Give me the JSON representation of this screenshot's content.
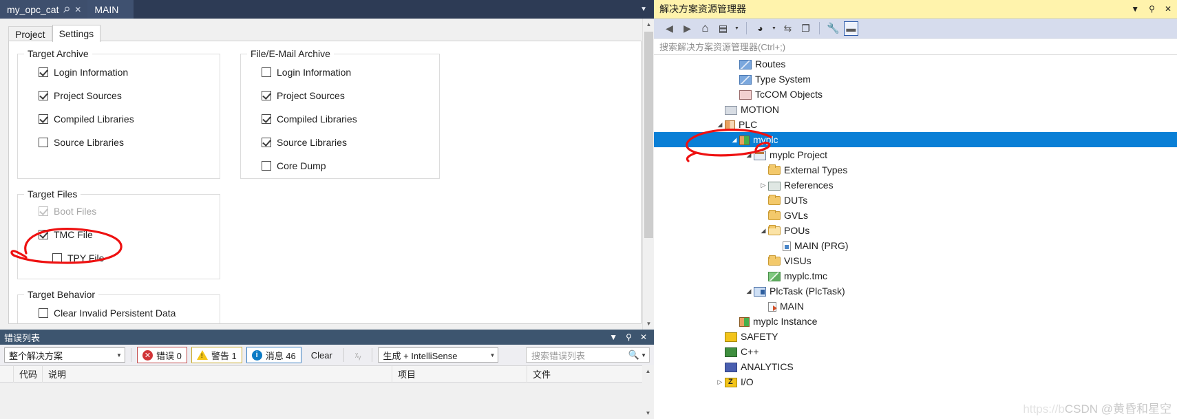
{
  "document_tabs": [
    {
      "label": "my_opc_cat",
      "pin_icon": "pin-icon",
      "close_icon": "close-icon",
      "active": true
    },
    {
      "label": "MAIN",
      "active": false
    }
  ],
  "tabstrip_overflow_icon": "chevron-down-icon",
  "inner_tabs": [
    {
      "label": "Project",
      "active": false
    },
    {
      "label": "Settings",
      "active": true
    }
  ],
  "settings": {
    "groups": [
      {
        "title": "Target Archive",
        "items": [
          {
            "label": "Login Information",
            "checked": true,
            "disabled": false
          },
          {
            "label": "Project Sources",
            "checked": true,
            "disabled": false
          },
          {
            "label": "Compiled Libraries",
            "checked": true,
            "disabled": false
          },
          {
            "label": "Source Libraries",
            "checked": false,
            "disabled": false
          }
        ]
      },
      {
        "title": "File/E-Mail Archive",
        "items": [
          {
            "label": "Login Information",
            "checked": false,
            "disabled": false
          },
          {
            "label": "Project Sources",
            "checked": true,
            "disabled": false
          },
          {
            "label": "Compiled Libraries",
            "checked": true,
            "disabled": false
          },
          {
            "label": "Source Libraries",
            "checked": true,
            "disabled": false
          },
          {
            "label": "Core Dump",
            "checked": false,
            "disabled": false
          }
        ]
      },
      {
        "title": "Target Files",
        "items": [
          {
            "label": "Boot Files",
            "checked": true,
            "disabled": true
          },
          {
            "label": "TMC File",
            "checked": true,
            "disabled": false
          },
          {
            "label": "TPY File",
            "checked": false,
            "disabled": false
          }
        ]
      },
      {
        "title": "Target Behavior",
        "items": [
          {
            "label": "Clear Invalid Persistent Data",
            "checked": false,
            "disabled": false
          }
        ]
      }
    ]
  },
  "error_list": {
    "title": "错误列表",
    "titlebar_icons": [
      "chevron-down-icon",
      "pin-icon",
      "close-icon"
    ],
    "scope_combo": {
      "value": "整个解决方案",
      "caret_icon": "chevron-down-icon"
    },
    "filters": [
      {
        "label": "错误 0",
        "icon": "error-icon"
      },
      {
        "label": "警告 1",
        "icon": "warning-icon"
      },
      {
        "label": "消息 46",
        "icon": "info-icon"
      }
    ],
    "clear_label": "Clear",
    "toggle_icon": "sort-xy-icon",
    "build_combo": {
      "value": "生成 + IntelliSense",
      "caret_icon": "chevron-down-icon"
    },
    "search": {
      "placeholder": "搜索错误列表",
      "icon": "search-icon",
      "caret_icon": "chevron-down-icon"
    },
    "columns": [
      "",
      "代码",
      "说明",
      "项目",
      "文件"
    ]
  },
  "solution_explorer": {
    "title": "解决方案资源管理器",
    "title_icons": [
      "chevron-down-icon",
      "pin-icon",
      "close-icon"
    ],
    "toolbar": [
      {
        "name": "back-icon",
        "glyph": "◄",
        "state": "disabled"
      },
      {
        "name": "forward-icon",
        "glyph": "►",
        "state": "disabled"
      },
      {
        "name": "home-icon",
        "glyph": "⌂",
        "state": "normal"
      },
      {
        "name": "sync-with-active-document-icon",
        "glyph": "▣",
        "state": "normal"
      },
      {
        "name": "sync-dropdown-caret-icon",
        "glyph": "▾",
        "state": "normal"
      },
      {
        "name": "pending-changes-filter-icon",
        "glyph": "◔",
        "state": "normal"
      },
      {
        "name": "filter-dropdown-caret-icon",
        "glyph": "▾",
        "state": "normal"
      },
      {
        "name": "refresh-icon",
        "glyph": "⇆",
        "state": "normal"
      },
      {
        "name": "show-all-files-icon",
        "glyph": "❐",
        "state": "normal"
      },
      {
        "name": "properties-wrench-icon",
        "glyph": "🔧",
        "state": "normal"
      },
      {
        "name": "collapse-icon",
        "glyph": "▬",
        "state": "selected"
      }
    ],
    "search_placeholder": "搜索解决方案资源管理器(Ctrl+;)",
    "tree": [
      {
        "label": "Routes",
        "indent": 4,
        "twisty": "",
        "icon": "routes-icon",
        "selected": false
      },
      {
        "label": "Type System",
        "indent": 4,
        "twisty": "",
        "icon": "type-system-icon",
        "selected": false
      },
      {
        "label": "TcCOM Objects",
        "indent": 4,
        "twisty": "",
        "icon": "tccom-icon",
        "selected": false
      },
      {
        "label": "MOTION",
        "indent": 3,
        "twisty": "",
        "icon": "motion-icon",
        "selected": false
      },
      {
        "label": "PLC",
        "indent": 3,
        "twisty": "▼",
        "icon": "plc-icon",
        "selected": false
      },
      {
        "label": "myplc",
        "indent": 4,
        "twisty": "▼",
        "icon": "plc-project-icon",
        "selected": true
      },
      {
        "label": "myplc Project",
        "indent": 5,
        "twisty": "▼",
        "icon": "project-icon",
        "selected": false
      },
      {
        "label": "External Types",
        "indent": 6,
        "twisty": "",
        "icon": "folder-icon",
        "selected": false
      },
      {
        "label": "References",
        "indent": 6,
        "twisty": "▶",
        "icon": "references-icon",
        "selected": false
      },
      {
        "label": "DUTs",
        "indent": 6,
        "twisty": "",
        "icon": "folder-icon",
        "selected": false
      },
      {
        "label": "GVLs",
        "indent": 6,
        "twisty": "",
        "icon": "folder-icon",
        "selected": false
      },
      {
        "label": "POUs",
        "indent": 6,
        "twisty": "▼",
        "icon": "folder-open-icon",
        "selected": false
      },
      {
        "label": "MAIN (PRG)",
        "indent": 7,
        "twisty": "",
        "icon": "pou-file-icon",
        "selected": false
      },
      {
        "label": "VISUs",
        "indent": 6,
        "twisty": "",
        "icon": "folder-icon",
        "selected": false
      },
      {
        "label": "myplc.tmc",
        "indent": 6,
        "twisty": "",
        "icon": "tmc-file-icon",
        "selected": false
      },
      {
        "label": "PlcTask (PlcTask)",
        "indent": 5,
        "twisty": "▼",
        "icon": "task-icon",
        "selected": false
      },
      {
        "label": "MAIN",
        "indent": 6,
        "twisty": "",
        "icon": "task-main-icon",
        "selected": false
      },
      {
        "label": "myplc Instance",
        "indent": 4,
        "twisty": "",
        "icon": "plc-instance-icon",
        "selected": false
      },
      {
        "label": "SAFETY",
        "indent": 3,
        "twisty": "",
        "icon": "safety-icon",
        "selected": false
      },
      {
        "label": "C++",
        "indent": 3,
        "twisty": "",
        "icon": "cpp-icon",
        "selected": false
      },
      {
        "label": "ANALYTICS",
        "indent": 3,
        "twisty": "",
        "icon": "analytics-icon",
        "selected": false
      },
      {
        "label": "I/O",
        "indent": 3,
        "twisty": "▶",
        "icon": "io-icon",
        "selected": false
      }
    ]
  },
  "annotations": {
    "color": "#ee1111",
    "marks": [
      "ellipse-around-tmc-file",
      "ellipse-around-myplc"
    ]
  },
  "watermark": {
    "url_text": "https://b",
    "brand": "CSDN",
    "author": "@黄昏和星空"
  }
}
